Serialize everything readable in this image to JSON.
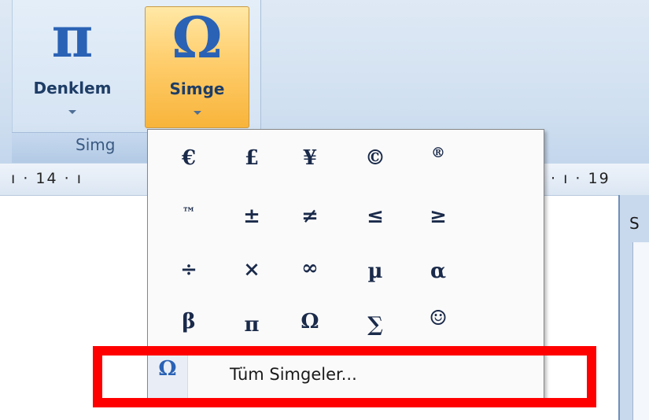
{
  "ribbon": {
    "group_label": "Simg",
    "buttons": [
      {
        "label": "Denklem",
        "glyph": "π"
      },
      {
        "label": "Simge",
        "glyph": "Ω"
      }
    ]
  },
  "ruler": {
    "left_text": "ı · 14 · ı",
    "right_text": "· ı · 19"
  },
  "side_window": {
    "title": "S"
  },
  "symbols": {
    "rows": [
      [
        "€",
        "£",
        "¥",
        "©",
        "®"
      ],
      [
        "™",
        "±",
        "≠",
        "≤",
        "≥"
      ],
      [
        "÷",
        "×",
        "∞",
        "µ",
        "α"
      ],
      [
        "β",
        "π",
        "Ω",
        "∑",
        "☺"
      ]
    ]
  },
  "all_symbols": {
    "glyph": "Ω",
    "label": "Tüm Simgeler..."
  },
  "colors": {
    "accent": "#2a62b5",
    "highlight": "#ff0000",
    "selected_button": "#f8b43a"
  }
}
